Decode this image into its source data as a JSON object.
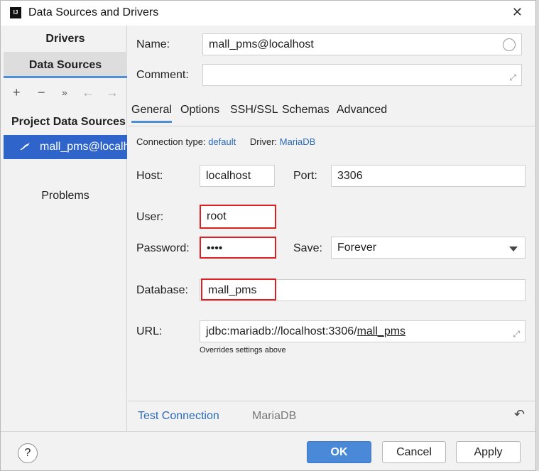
{
  "window": {
    "title": "Data Sources and Drivers",
    "close_glyph": "✕"
  },
  "sidebar": {
    "tab_drivers": "Drivers",
    "tab_data_sources": "Data Sources",
    "toolbar": {
      "add": "+",
      "remove": "−",
      "more": "»",
      "back": "←",
      "forward": "→"
    },
    "section_title": "Project Data Sources",
    "selected_item": "mall_pms@localhost",
    "problems": "Problems"
  },
  "form": {
    "name_label": "Name:",
    "name_value": "mall_pms@localhost",
    "comment_label": "Comment:",
    "comment_value": "",
    "tabs": [
      "General",
      "Options",
      "SSH/SSL",
      "Schemas",
      "Advanced"
    ],
    "connection_type_label": "Connection type:",
    "connection_type_value": "default",
    "driver_label": "Driver:",
    "driver_value": "MariaDB",
    "host_label": "Host:",
    "host_value": "localhost",
    "port_label": "Port:",
    "port_value": "3306",
    "user_label": "User:",
    "user_value": "root",
    "password_label": "Password:",
    "password_value": "••••",
    "save_label": "Save:",
    "save_value": "Forever",
    "database_label": "Database:",
    "database_value": "mall_pms",
    "url_label": "URL:",
    "url_prefix": "jdbc:mariadb://localhost:3306/",
    "url_db": "mall_pms",
    "url_hint": "Overrides settings above"
  },
  "bottom_bar": {
    "test_connection": "Test Connection",
    "driver_name": "MariaDB",
    "undo_glyph": "↶"
  },
  "footer": {
    "help": "?",
    "ok": "OK",
    "cancel": "Cancel",
    "apply": "Apply"
  },
  "colors": {
    "accent": "#4a88d8",
    "selection": "#2f65ca",
    "highlight_border": "#e02020",
    "link": "#2b6bb7"
  }
}
